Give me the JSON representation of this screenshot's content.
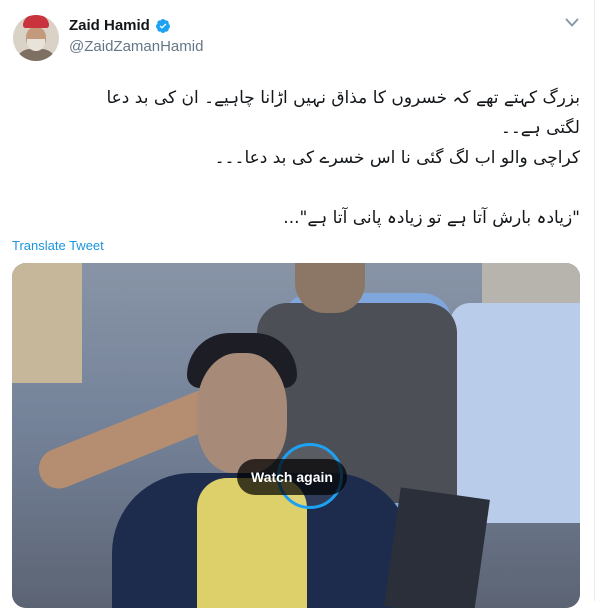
{
  "author": {
    "display_name": "Zaid Hamid",
    "handle": "@ZaidZamanHamid",
    "verified": true
  },
  "tweet": {
    "lines": [
      "بزرگ کہتے تھے کہ خسروں کا مذاق نہیں اڑانا چاہیے۔ ان کی بد دعا",
      "لگتی ہے۔۔",
      "کراچی والو اب لگ گئی نا اس خسرے کی بد دعا۔۔۔",
      "",
      "\"زیادہ بارش آتا ہے تو زیادہ پانی آتا ہے\"..."
    ],
    "translate_label": "Translate Tweet"
  },
  "media": {
    "overlay_label": "Watch again"
  },
  "colors": {
    "link": "#1b95e0",
    "accent": "#1da1f2",
    "text": "#14171a",
    "secondary_text": "#657786"
  },
  "icons": {
    "verified": "verified-badge-icon",
    "menu": "chevron-down-icon",
    "replay": "replay-ring-icon"
  }
}
